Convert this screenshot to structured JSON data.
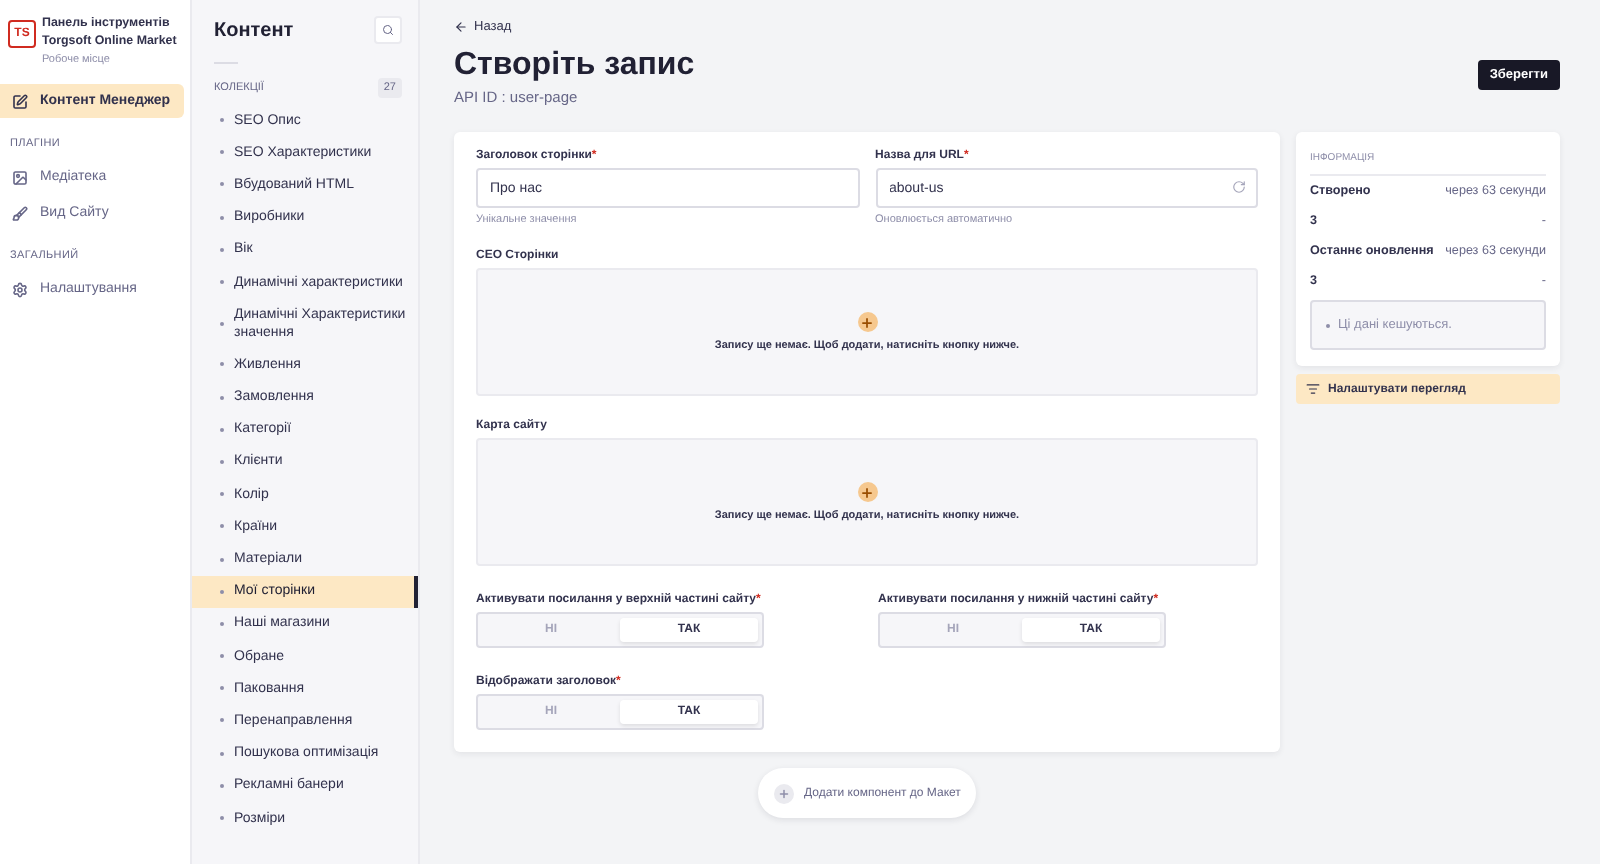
{
  "app": {
    "title": "Панель інструментів Torgsoft Online Market",
    "subtitle": "Робоче місце",
    "logo": "TS"
  },
  "nav_groups": [
    {
      "items": [
        {
          "kind": "content",
          "label": "Контент Менеджер",
          "selected": true
        }
      ]
    },
    {
      "heading": "ПЛАГІНИ",
      "items": [
        {
          "kind": "media",
          "label": "Медіатека",
          "selected": false
        },
        {
          "kind": "site",
          "label": "Вид Сайту",
          "selected": false
        }
      ]
    },
    {
      "heading": "ЗАГАЛЬНИЙ",
      "items": [
        {
          "kind": "settings",
          "label": "Налаштування",
          "selected": false
        }
      ]
    }
  ],
  "content_panel": {
    "title": "Контент",
    "collections_heading": "КОЛЕКЦІЇ",
    "count": "27",
    "items": [
      {
        "label": "SEO Опис",
        "selected": false
      },
      {
        "label": "SEO Характеристики",
        "selected": false
      },
      {
        "label": "Вбудований HTML",
        "selected": false
      },
      {
        "label": "Виробники",
        "selected": false
      },
      {
        "label": "Вік",
        "selected": false
      },
      {
        "label": "Динамічні характеристики",
        "selected": false
      },
      {
        "label": "Динамічні Характеристики значення",
        "selected": false
      },
      {
        "label": "Живлення",
        "selected": false
      },
      {
        "label": "Замовлення",
        "selected": false
      },
      {
        "label": "Категорії",
        "selected": false
      },
      {
        "label": "Клієнти",
        "selected": false
      },
      {
        "label": "Колір",
        "selected": false
      },
      {
        "label": "Країни",
        "selected": false
      },
      {
        "label": "Матеріали",
        "selected": false
      },
      {
        "label": "Мої сторінки",
        "selected": true
      },
      {
        "label": "Наші магазини",
        "selected": false
      },
      {
        "label": "Обране",
        "selected": false
      },
      {
        "label": "Паковання",
        "selected": false
      },
      {
        "label": "Перенаправлення",
        "selected": false
      },
      {
        "label": "Пошукова оптимізація",
        "selected": false
      },
      {
        "label": "Рекламні банери",
        "selected": false
      },
      {
        "label": "Розміри",
        "selected": false
      }
    ]
  },
  "header": {
    "back": "Назад",
    "title": "Створіть запис",
    "api_id": "API ID : user-page",
    "save": "Зберегти"
  },
  "fields": [
    {
      "label": "Заголовок сторінки",
      "required_mark": "*",
      "value": "Про нас",
      "hint": "Унікальне значення",
      "regenerate": false
    },
    {
      "label": "Назва для URL",
      "required_mark": "*",
      "value": "about-us",
      "hint": "Оновлюється автоматично",
      "regenerate": true
    }
  ],
  "components": [
    {
      "label": "СЕО Сторінки",
      "empty_text": "Запису ще немає. Щоб додати, натисніть кнопку нижче."
    },
    {
      "label": "Карта сайту",
      "empty_text": "Запису ще немає. Щоб додати, натисніть кнопку нижче."
    }
  ],
  "toggles": [
    {
      "label": "Активувати посилання у верхній частині сайту",
      "required_mark": "*",
      "options": [
        {
          "label": "НІ",
          "selected": false
        },
        {
          "label": "ТАК",
          "selected": true
        }
      ]
    },
    {
      "label": "Активувати посилання у нижній частині сайту",
      "required_mark": "*",
      "options": [
        {
          "label": "НІ",
          "selected": false
        },
        {
          "label": "ТАК",
          "selected": true
        }
      ]
    },
    {
      "label": "Відображати заголовок",
      "required_mark": "*",
      "options": [
        {
          "label": "НІ",
          "selected": false
        },
        {
          "label": "ТАК",
          "selected": true
        }
      ]
    }
  ],
  "add_component": "Додати компонент до Макет",
  "info": {
    "heading": "ІНФОРМАЦІЯ",
    "rows": [
      {
        "label": "Створено",
        "value": "через 63 секунди"
      },
      {
        "label": "3",
        "value": "-"
      },
      {
        "label": "Останнє оновлення",
        "value": "через 63 секунди"
      },
      {
        "label": "3",
        "value": "-"
      }
    ],
    "note": "Ці дані кешуються."
  },
  "configure_view": "Налаштувати перегляд"
}
